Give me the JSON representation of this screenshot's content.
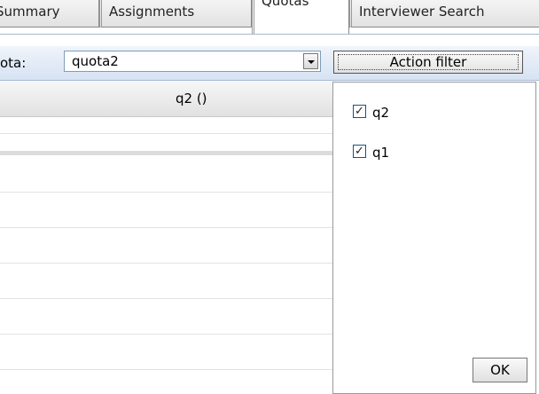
{
  "tabs": [
    {
      "label": "Summary"
    },
    {
      "label": "Assignments"
    },
    {
      "label": "Quotas"
    },
    {
      "label": "Interviewer Search"
    }
  ],
  "toolbar": {
    "quota_label": "ota:",
    "quota_value": "quota2",
    "action_filter_label": "Action filter"
  },
  "grid": {
    "column_header": "q2 ()"
  },
  "filter_panel": {
    "items": [
      {
        "label": "q2",
        "checked": true
      },
      {
        "label": "q1",
        "checked": true
      }
    ],
    "ok_label": "OK"
  },
  "check_glyph": "✓"
}
